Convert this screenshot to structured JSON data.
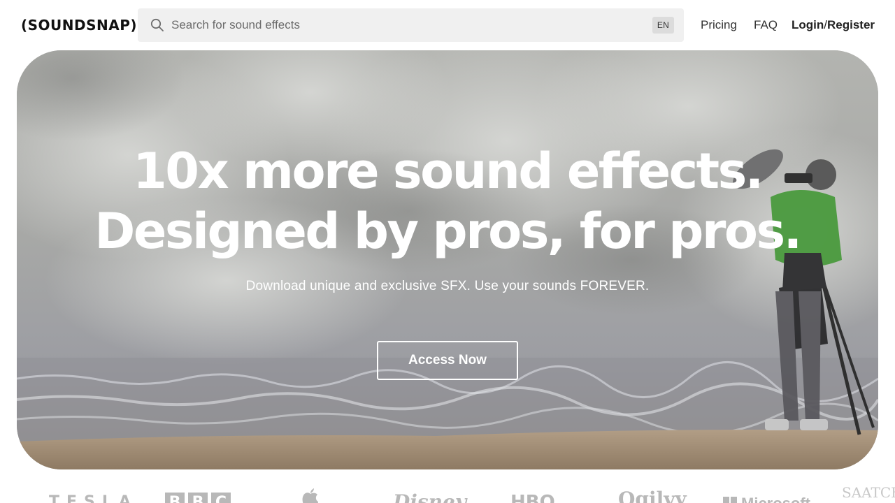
{
  "header": {
    "logo": "(SOUNDSNAP)",
    "search": {
      "placeholder": "Search for sound effects",
      "value": "",
      "language": "EN",
      "icon": "search-icon"
    },
    "nav": {
      "pricing": "Pricing",
      "faq": "FAQ",
      "login": "Login",
      "separator": "/",
      "register": "Register"
    }
  },
  "hero": {
    "headline_line1": "10x more sound effects.",
    "headline_line2": "Designed by pros, for pros.",
    "subheadline": "Download unique and exclusive SFX. Use your sounds FOREVER.",
    "cta_label": "Access Now"
  },
  "client_logos": [
    "TESLA",
    "BBC",
    "Apple",
    "Disney",
    "HBO",
    "Ogilvy",
    "Microsoft",
    "SAATCHI"
  ],
  "colors": {
    "text_dark": "#222222",
    "search_bg": "#f0f0f0",
    "logo_gray": "#b8b8b8",
    "hero_text": "#ffffff"
  }
}
